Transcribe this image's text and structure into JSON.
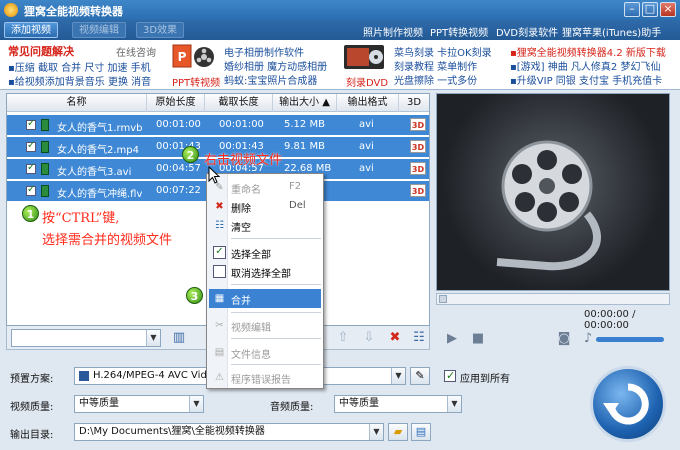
{
  "app": {
    "title": "狸窝全能视频转换器"
  },
  "menubar": {
    "tabs": [
      "添加视频",
      "视频编辑",
      "3D效果"
    ],
    "links": [
      "照片制作视频",
      "PPT转换视频",
      "DVD刻录软件",
      "狸窝苹果(iTunes)助手"
    ]
  },
  "banner": {
    "faq_title": "常见问题解决",
    "online_help": "在线咨询",
    "faq_line1": "▪压缩 截取 合并 尺寸 加速 手机",
    "faq_line2": "▪给视频添加背景音乐 更换 消音",
    "ppt_label": "PPT转视频",
    "album_1": "电子相册制作软件",
    "album_2": "婚纱相册 魔方动感相册",
    "album_3": "蚂蚁:宝宝照片合成器",
    "dvd_label": "刻录DVD",
    "dvd_1": "菜鸟刻录 卡拉OK刻录",
    "dvd_2": "刻录教程 菜单制作",
    "dvd_3": "光盘擦除 一式多份",
    "right_1": "▪狸窝全能视频转换器4.2 新版下载",
    "right_2": "▪[游戏] 神曲 凡人修真2 梦幻飞仙",
    "right_3": "▪升级VIP 同银 支付宝 手机充值卡"
  },
  "columns": [
    "名称",
    "原始长度",
    "截取长度",
    "输出大小 ▲",
    "输出格式",
    "3D"
  ],
  "files": [
    {
      "name": "女人的香气1.rmvb",
      "orig": "00:01:00",
      "cut": "00:01:00",
      "size": "5.12 MB",
      "fmt": "avi"
    },
    {
      "name": "女人的香气2.mp4",
      "orig": "00:01:43",
      "cut": "00:01:43",
      "size": "9.81 MB",
      "fmt": "avi"
    },
    {
      "name": "女人的香气3.avi",
      "orig": "00:04:57",
      "cut": "00:04:57",
      "size": "22.68 MB",
      "fmt": "avi"
    },
    {
      "name": "女人的香气冲绳.flv",
      "orig": "00:07:22",
      "cut": "",
      "size": "",
      "fmt": ""
    }
  ],
  "badge_3d": "3D",
  "context_menu": {
    "rename": "重命名",
    "rename_key": "F2",
    "delete": "删除",
    "delete_key": "Del",
    "clear": "清空",
    "select_all": "选择全部",
    "deselect_all": "取消选择全部",
    "merge": "合并",
    "video_edit": "视频编辑",
    "file_info": "文件信息",
    "error_report": "程序错误报告"
  },
  "annotations": {
    "step1_line1": "按“CTRL”键,",
    "step1_line2": "选择需合并的视频文件",
    "step2": "右击视频文件",
    "n1": "1",
    "n2": "2",
    "n3": "3"
  },
  "preview": {
    "time": "00:00:00 / 00:00:00"
  },
  "bottom": {
    "preset_label": "预置方案:",
    "preset_value": "H.264/MPEG-4 AVC Video",
    "apply_all": "应用到所有",
    "video_quality_label": "视频质量:",
    "video_quality": "中等质量",
    "audio_quality_label": "音频质量:",
    "audio_quality": "中等质量",
    "output_label": "输出目录:",
    "output_path": "D:\\My Documents\\狸窝\\全能视频转换器"
  },
  "colors": {
    "selection": "#3e88d6",
    "annotation": "#ff2a1a",
    "title_bar": "#2a6eb0"
  }
}
